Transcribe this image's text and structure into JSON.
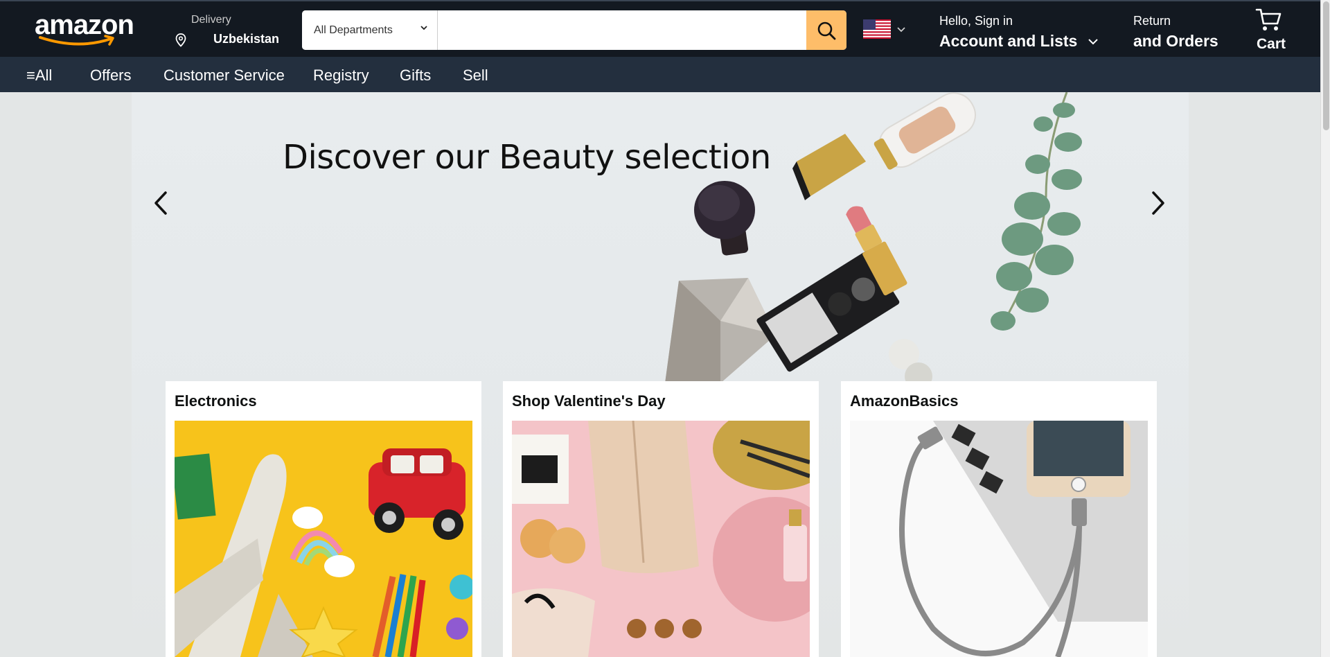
{
  "header": {
    "logo": "amazon",
    "deliver": {
      "line1": "Delivery",
      "line2": "Uzbekistan"
    },
    "search": {
      "department": "All Departments",
      "placeholder": "",
      "value": ""
    },
    "account": {
      "line1": "Hello, Sign in",
      "line2": "Account and Lists"
    },
    "orders": {
      "line1": "Return",
      "line2": "and Orders"
    },
    "cart": {
      "label": "Cart"
    }
  },
  "nav": {
    "items": [
      "≡All",
      "Offers",
      "Customer Service",
      "Registry",
      "Gifts",
      "Sell"
    ]
  },
  "hero": {
    "title": "Discover our Beauty selection"
  },
  "cards": [
    {
      "title": "Electronics"
    },
    {
      "title": "Shop Valentine's Day"
    },
    {
      "title": "AmazonBasics"
    }
  ],
  "colors": {
    "header_bg": "#131921",
    "nav_bg": "#232f3e",
    "search_button": "#febd69",
    "accent_orange": "#ff9900",
    "page_bg": "#e3e6e6"
  }
}
